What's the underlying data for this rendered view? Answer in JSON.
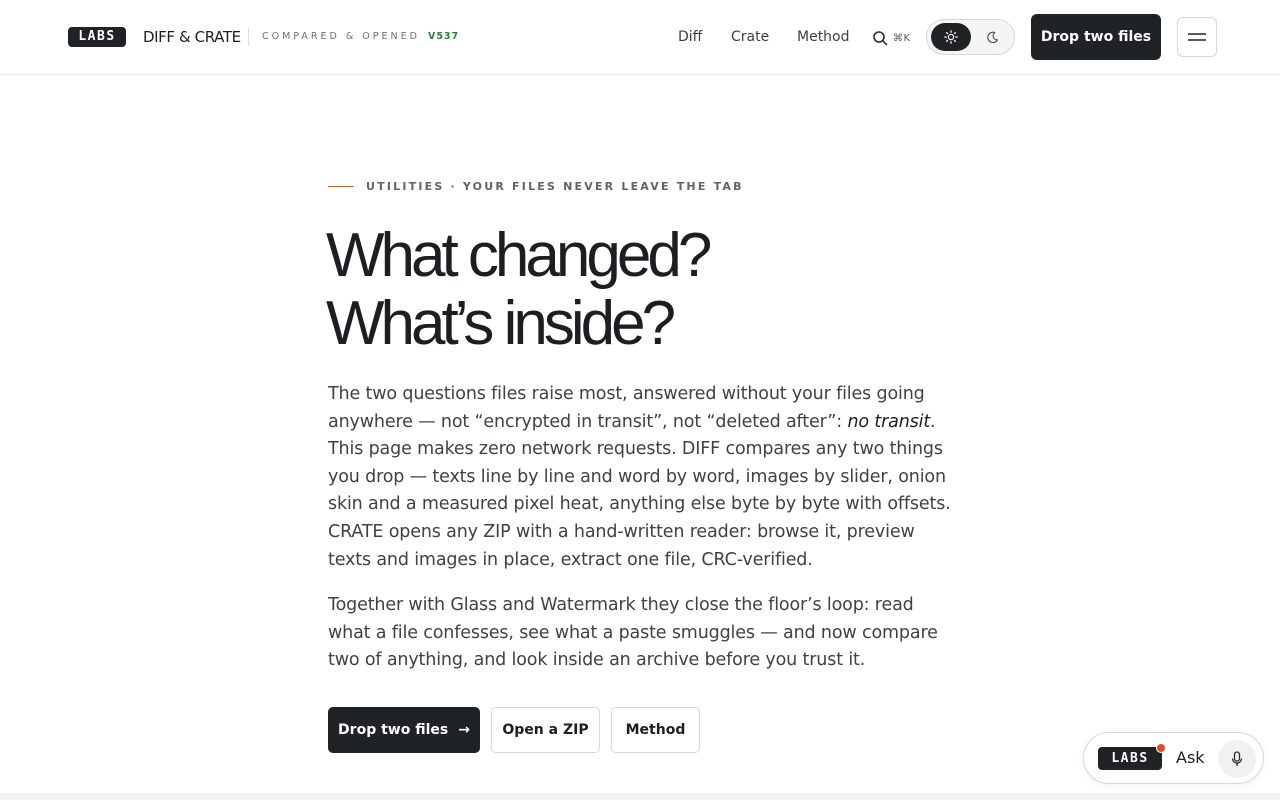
{
  "header": {
    "logo_text": "LABS",
    "brand": "DIFF & CRATE",
    "tagline": "COMPARED & OPENED",
    "version": "V537",
    "nav": [
      {
        "label": "Diff"
      },
      {
        "label": "Crate"
      },
      {
        "label": "Method"
      }
    ],
    "search_shortcut": "⌘K",
    "theme": {
      "active": "light",
      "icons": [
        "sun-icon",
        "moon-icon"
      ]
    },
    "cta_label": "Drop two files",
    "menu_icon": "hamburger-icon"
  },
  "hero": {
    "eyebrow": "UTILITIES · YOUR FILES NEVER LEAVE THE TAB",
    "headline_line1": "What changed?",
    "headline_line2": "What’s inside?",
    "para1_a": "The two questions files raise most, answered without your files going anywhere — not “encrypted in transit”, not “deleted after”: ",
    "para1_em": "no transit",
    "para1_b": ". This page makes zero network requests. DIFF compares any two things you drop — texts line by line and word by word, images by slider, onion skin and a measured pixel heat, anything else byte by byte with offsets. CRATE opens any ZIP with a hand-written reader: browse it, preview texts and images in place, extract one file, CRC-verified.",
    "para2": "Together with Glass and Watermark they close the floor’s loop: read what a file confesses, see what a paste smuggles — and now compare two of anything, and look inside an archive before you trust it.",
    "buttons": {
      "primary": "Drop two files",
      "primary_arrow": "→",
      "zip": "Open a ZIP",
      "method": "Method"
    }
  },
  "ask_widget": {
    "logo_text": "LABS",
    "label": "Ask",
    "mic_icon": "microphone-icon"
  },
  "colors": {
    "ink": "#1f2326",
    "accent_orange": "#c86a2a",
    "version_green": "#2e7d3a",
    "notification_dot": "#d6522a"
  }
}
